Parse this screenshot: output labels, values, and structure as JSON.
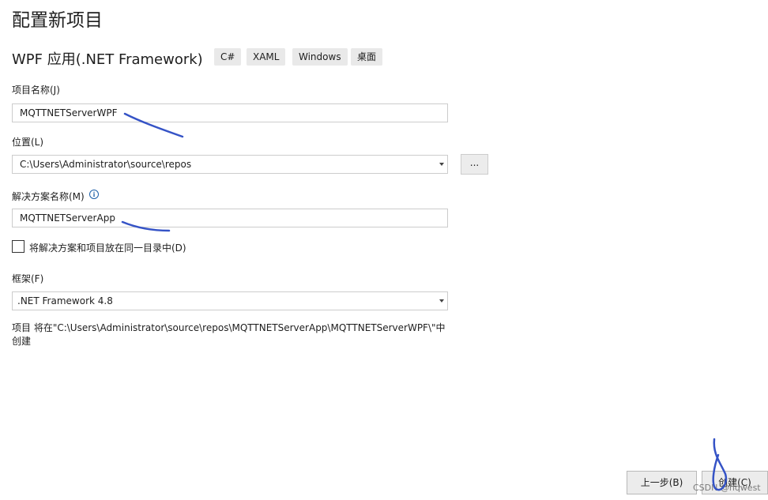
{
  "page_title": "配置新项目",
  "template": {
    "name": "WPF 应用(.NET Framework)",
    "tags": [
      "C#",
      "XAML",
      "Windows",
      "桌面"
    ]
  },
  "project_name": {
    "label": "项目名称(J)",
    "value": "MQTTNETServerWPF"
  },
  "location": {
    "label": "位置(L)",
    "value": "C:\\Users\\Administrator\\source\\repos",
    "browse_label": "..."
  },
  "solution_name": {
    "label": "解决方案名称(M)",
    "info_icon": "info-icon",
    "value": "MQTTNETServerApp"
  },
  "same_directory": {
    "label": "将解决方案和项目放在同一目录中(D)",
    "checked": false
  },
  "framework": {
    "label": "框架(F)",
    "value": ".NET Framework 4.8"
  },
  "summary": {
    "line1": "项目 将在\"C:\\Users\\Administrator\\source\\repos\\MQTTNETServerApp\\MQTTNETServerWPF\\\"中",
    "line2": "创建"
  },
  "footer": {
    "back_label": "上一步(B)",
    "create_label": "创建(C)"
  },
  "watermark": "CSDN @hqwest",
  "colors": {
    "annotation_ink": "#3553c6",
    "info_accent": "#1c5fa8"
  }
}
